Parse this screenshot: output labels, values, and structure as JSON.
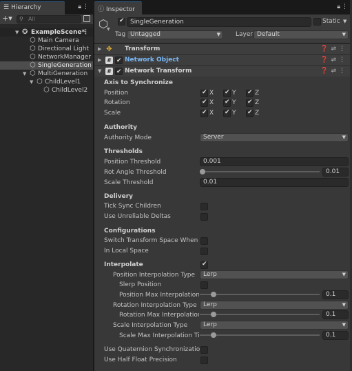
{
  "hierarchy": {
    "tab_label": "Hierarchy",
    "search_placeholder": "All",
    "scene": "ExampleScene*",
    "items": [
      {
        "label": "Main Camera"
      },
      {
        "label": "Directional Light"
      },
      {
        "label": "NetworkManager"
      },
      {
        "label": "SingleGeneration",
        "selected": true
      },
      {
        "label": "MultiGeneration"
      },
      {
        "label": "ChildLevel1"
      },
      {
        "label": "ChildLevel2"
      }
    ]
  },
  "inspector": {
    "tab_label": "Inspector",
    "object_name": "SingleGeneration",
    "static_label": "Static",
    "tag_label": "Tag",
    "tag_value": "Untagged",
    "layer_label": "Layer",
    "layer_value": "Default",
    "components": [
      {
        "name": "Transform"
      },
      {
        "name": "Network Object"
      },
      {
        "name": "Network Transform"
      }
    ]
  },
  "network_transform": {
    "axis_section": "Axis to Synchronize",
    "axis_rows": [
      {
        "label": "Position"
      },
      {
        "label": "Rotation"
      },
      {
        "label": "Scale"
      }
    ],
    "axis_names": [
      "X",
      "Y",
      "Z"
    ],
    "authority_section": "Authority",
    "authority_mode_label": "Authority Mode",
    "authority_mode_value": "Server",
    "thresholds_section": "Thresholds",
    "position_threshold_label": "Position Threshold",
    "position_threshold_value": "0.001",
    "rot_angle_threshold_label": "Rot Angle Threshold",
    "rot_angle_threshold_value": "0.01",
    "scale_threshold_label": "Scale Threshold",
    "scale_threshold_value": "0.01",
    "delivery_section": "Delivery",
    "tick_sync_label": "Tick Sync Children",
    "unreliable_label": "Use Unreliable Deltas",
    "config_section": "Configurations",
    "switch_space_label": "Switch Transform Space When Pa",
    "in_local_space_label": "In Local Space",
    "interpolate_label": "Interpolate",
    "pos_interp_type_label": "Position Interpolation Type",
    "pos_interp_type_value": "Lerp",
    "slerp_label": "Slerp Position",
    "pos_max_interp_label": "Position Max Interpolation T",
    "pos_max_interp_value": "0.1",
    "rot_interp_type_label": "Rotation Interpolation Type",
    "rot_interp_type_value": "Lerp",
    "rot_max_interp_label": "Rotation Max Interpolation T",
    "rot_max_interp_value": "0.1",
    "scale_interp_type_label": "Scale Interpolation Type",
    "scale_interp_type_value": "Lerp",
    "scale_max_interp_label": "Scale Max Interpolation Tim",
    "scale_max_interp_value": "0.1",
    "quaternion_label": "Use Quaternion Synchronization",
    "half_float_label": "Use Half Float Precision"
  },
  "icons": {
    "lock": "lock-icon",
    "menu": "kebab-menu-icon",
    "cube": "gameobject-icon",
    "help": "help-icon",
    "settings": "preset-icon"
  }
}
